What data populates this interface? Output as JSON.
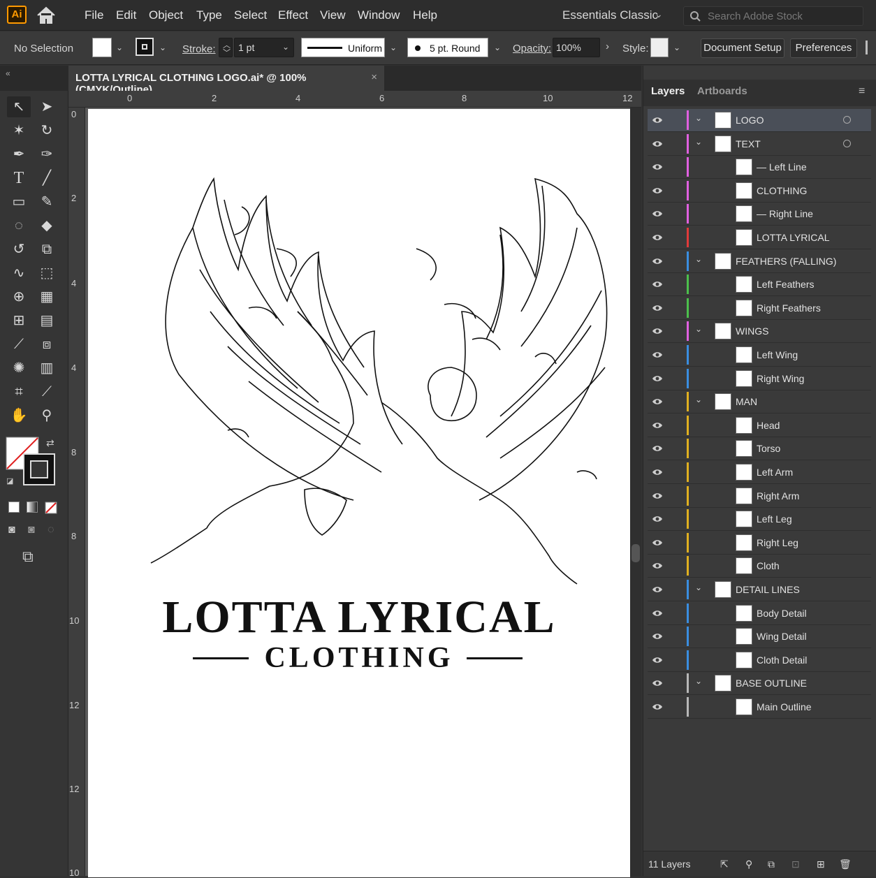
{
  "app": {
    "logo": "Ai"
  },
  "menu": [
    "File",
    "Edit",
    "Object",
    "Type",
    "Select",
    "Effect",
    "View",
    "Window",
    "Help"
  ],
  "workspace": "Essentials Classic",
  "search": {
    "placeholder": "Search Adobe Stock"
  },
  "control_bar": {
    "selection": "No Selection",
    "stroke_label": "Stroke:",
    "stroke_value": "1 pt",
    "stroke_profile": "Uniform",
    "brush": "5 pt. Round",
    "opacity_label": "Opacity:",
    "opacity_value": "100%",
    "style_label": "Style:",
    "document_setup": "Document Setup",
    "preferences": "Preferences"
  },
  "document_tab": {
    "title": "LOTTA LYRICAL CLOTHING LOGO.ai* @ 100% (CMYK/Outline)",
    "close": "×"
  },
  "ruler_top": [
    "0",
    "2",
    "4",
    "6",
    "8",
    "10",
    "12"
  ],
  "ruler_left": [
    "0",
    "2",
    "4",
    "4",
    "8",
    "8",
    "10",
    "12",
    "12",
    "10"
  ],
  "artwork": {
    "title": "LOTTA LYRICAL",
    "subtitle": "CLOTHING"
  },
  "panel": {
    "tabs": [
      "Layers",
      "Artboards"
    ],
    "footer": "11 Layers",
    "layers": [
      {
        "name": "LOGO",
        "level": 0,
        "color": "#e060e0",
        "expanded": true,
        "selected": true
      },
      {
        "name": "TEXT",
        "level": 0,
        "color": "#e060e0",
        "expanded": true
      },
      {
        "name": "— Left Line",
        "level": 1,
        "color": "#e060e0"
      },
      {
        "name": "CLOTHING",
        "level": 1,
        "color": "#e060e0"
      },
      {
        "name": "— Right Line",
        "level": 1,
        "color": "#e060e0"
      },
      {
        "name": "LOTTA LYRICAL",
        "level": 1,
        "color": "#e03a3a"
      },
      {
        "name": "FEATHERS (FALLING)",
        "level": 0,
        "color": "#3a8ee0",
        "expanded": true
      },
      {
        "name": "Left Feathers",
        "level": 1,
        "color": "#4cc04c"
      },
      {
        "name": "Right Feathers",
        "level": 1,
        "color": "#4cc04c"
      },
      {
        "name": "WINGS",
        "level": 0,
        "color": "#e060e0",
        "expanded": true
      },
      {
        "name": "Left Wing",
        "level": 1,
        "color": "#3a8ee0"
      },
      {
        "name": "Right Wing",
        "level": 1,
        "color": "#3a8ee0"
      },
      {
        "name": "MAN",
        "level": 0,
        "color": "#e0b020",
        "expanded": true
      },
      {
        "name": "Head",
        "level": 1,
        "color": "#e0b020"
      },
      {
        "name": "Torso",
        "level": 1,
        "color": "#e0b020"
      },
      {
        "name": "Left Arm",
        "level": 1,
        "color": "#e0b020"
      },
      {
        "name": "Right Arm",
        "level": 1,
        "color": "#e0b020"
      },
      {
        "name": "Left Leg",
        "level": 1,
        "color": "#e0b020"
      },
      {
        "name": "Right Leg",
        "level": 1,
        "color": "#e0b020"
      },
      {
        "name": "Cloth",
        "level": 1,
        "color": "#e0b020"
      },
      {
        "name": "DETAIL LINES",
        "level": 0,
        "color": "#3a8ee0",
        "expanded": true
      },
      {
        "name": "Body Detail",
        "level": 1,
        "color": "#3a8ee0"
      },
      {
        "name": "Wing Detail",
        "level": 1,
        "color": "#3a8ee0"
      },
      {
        "name": "Cloth Detail",
        "level": 1,
        "color": "#3a8ee0"
      },
      {
        "name": "BASE OUTLINE",
        "level": 0,
        "color": "#b8b8b8",
        "expanded": true
      },
      {
        "name": "Main Outline",
        "level": 1,
        "color": "#b8b8b8"
      }
    ]
  }
}
